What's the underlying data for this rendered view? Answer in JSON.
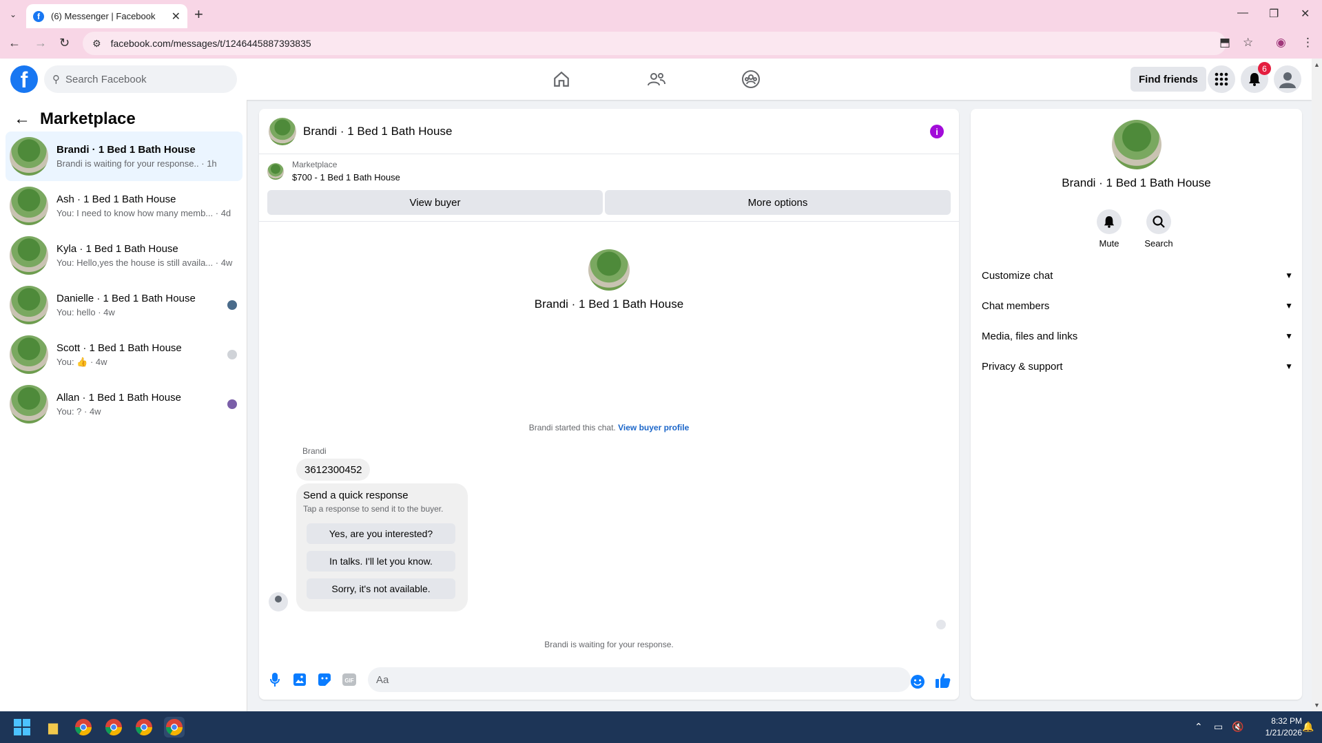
{
  "browser": {
    "tab_title": "(6) Messenger | Facebook",
    "url": "facebook.com/messages/t/1246445887393835"
  },
  "header": {
    "logo_letter": "f",
    "search_placeholder": "Search Facebook",
    "find_friends": "Find friends",
    "notification_count": "6"
  },
  "sidebar": {
    "title": "Marketplace",
    "conversations": [
      {
        "name": "Brandi · 1 Bed 1 Bath House",
        "preview": "Brandi is waiting for your response.. · 1h",
        "active": true
      },
      {
        "name": "Ash · 1 Bed 1 Bath House",
        "preview": "You: I need to know how many memb... · 4d"
      },
      {
        "name": "Kyla · 1 Bed 1 Bath House",
        "preview": "You: Hello,yes the house is still availa... · 4w"
      },
      {
        "name": "Danielle · 1 Bed 1 Bath House",
        "preview": "You: hello · 4w"
      },
      {
        "name": "Scott · 1 Bed 1 Bath House",
        "preview": "You: 👍 · 4w"
      },
      {
        "name": "Allan · 1 Bed 1 Bath House",
        "preview": "You: ? · 4w"
      }
    ]
  },
  "chat": {
    "title": "Brandi · 1 Bed 1 Bath House",
    "marketplace_label": "Marketplace",
    "listing": "$700 - 1 Bed 1 Bath House",
    "view_buyer": "View buyer",
    "more_options": "More options",
    "hero_name": "Brandi · 1 Bed 1 Bath House",
    "started_note": "Brandi started this chat.",
    "view_buyer_profile": "View buyer profile",
    "sender": "Brandi",
    "message": "3612300452",
    "quick_title": "Send a quick response",
    "quick_sub": "Tap a response to send it to the buyer.",
    "quick_options": [
      "Yes, are you interested?",
      "In talks. I'll let you know.",
      "Sorry, it's not available."
    ],
    "waiting": "Brandi is waiting for your response.",
    "composer_placeholder": "Aa"
  },
  "details": {
    "name": "Brandi · 1 Bed 1 Bath House",
    "mute": "Mute",
    "search": "Search",
    "sections": [
      "Customize chat",
      "Chat members",
      "Media, files and links",
      "Privacy & support"
    ]
  },
  "taskbar": {
    "time": "8:32 PM",
    "date": "1/21/2026"
  },
  "colors": {
    "brand": "#1877f2",
    "accent_purple": "#a20cd9",
    "active_row": "#ebf5ff",
    "badge": "#e41e3f"
  }
}
